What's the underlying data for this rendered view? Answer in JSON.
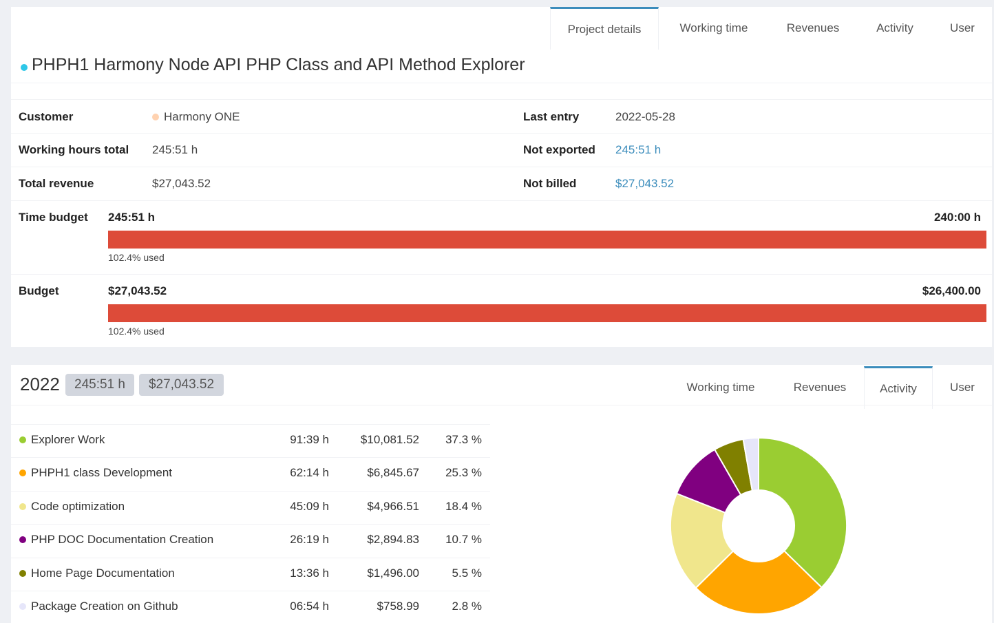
{
  "project": {
    "title": "PHPH1 Harmony Node API PHP Class and API Method Explorer",
    "tabs": [
      "Project details",
      "Working time",
      "Revenues",
      "Activity",
      "User"
    ],
    "active_tab": "Project details",
    "customer_label": "Customer",
    "customer": "Harmony ONE",
    "working_hours_label": "Working hours total",
    "working_hours": "245:51 h",
    "total_revenue_label": "Total revenue",
    "total_revenue": "$27,043.52",
    "last_entry_label": "Last entry",
    "last_entry": "2022-05-28",
    "not_exported_label": "Not exported",
    "not_exported": "245:51 h",
    "not_billed_label": "Not billed",
    "not_billed": "$27,043.52",
    "time_budget_label": "Time budget",
    "time_budget_used": "245:51 h",
    "time_budget_total": "240:00 h",
    "time_budget_pct": "102.4% used",
    "budget_label": "Budget",
    "budget_used": "$27,043.52",
    "budget_total": "$26,400.00",
    "budget_pct": "102.4% used"
  },
  "yearly": {
    "year": "2022",
    "hours_badge": "245:51 h",
    "revenue_badge": "$27,043.52",
    "tabs": [
      "Working time",
      "Revenues",
      "Activity",
      "User"
    ],
    "active_tab": "Activity",
    "activities": [
      {
        "name": "Explorer Work",
        "hours": "91:39 h",
        "revenue": "$10,081.52",
        "percent": "37.3 %",
        "color": "#9acd32"
      },
      {
        "name": "PHPH1 class Development",
        "hours": "62:14 h",
        "revenue": "$6,845.67",
        "percent": "25.3 %",
        "color": "#ffa500"
      },
      {
        "name": "Code optimization",
        "hours": "45:09 h",
        "revenue": "$4,966.51",
        "percent": "18.4 %",
        "color": "#f0e68c"
      },
      {
        "name": "PHP DOC Documentation Creation",
        "hours": "26:19 h",
        "revenue": "$2,894.83",
        "percent": "10.7 %",
        "color": "#800080"
      },
      {
        "name": "Home Page Documentation",
        "hours": "13:36 h",
        "revenue": "$1,496.00",
        "percent": "5.5 %",
        "color": "#808000"
      },
      {
        "name": "Package Creation on Github",
        "hours": "06:54 h",
        "revenue": "$758.99",
        "percent": "2.8 %",
        "color": "#e6e6fa"
      }
    ]
  },
  "chart_data": {
    "type": "pie",
    "categories": [
      "Explorer Work",
      "PHPH1 class Development",
      "Code optimization",
      "PHP DOC Documentation Creation",
      "Home Page Documentation",
      "Package Creation on Github"
    ],
    "values": [
      37.3,
      25.3,
      18.4,
      10.7,
      5.5,
      2.8
    ],
    "colors": [
      "#9acd32",
      "#ffa500",
      "#f0e68c",
      "#800080",
      "#808000",
      "#e6e6fa"
    ],
    "donut": true
  }
}
